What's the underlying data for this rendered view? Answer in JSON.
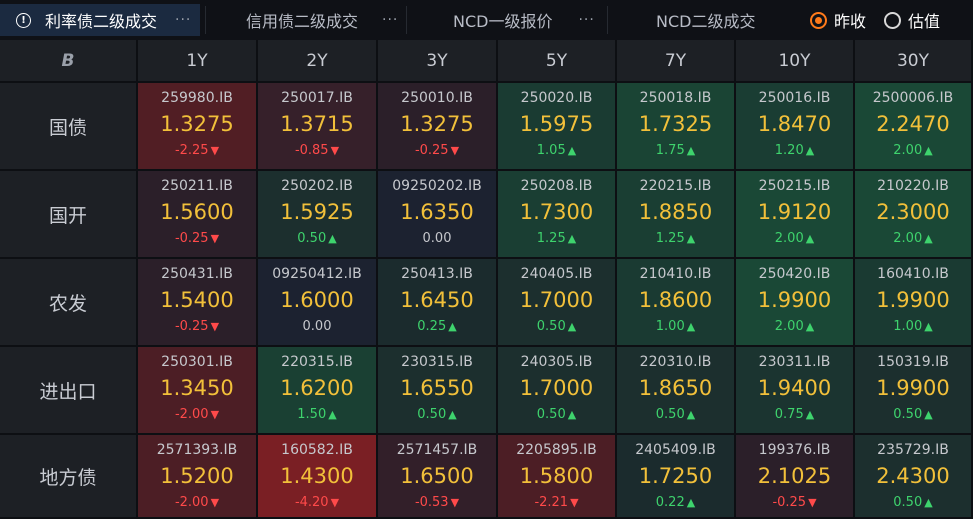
{
  "tabs": [
    {
      "label": "利率债二级成交",
      "more": "···",
      "active": true,
      "info_icon": "!"
    },
    {
      "label": "信用债二级成交",
      "more": "···",
      "active": false
    },
    {
      "label": "NCD一级报价",
      "more": "···",
      "active": false
    },
    {
      "label": "NCD二级成交",
      "more": "",
      "active": false
    }
  ],
  "radio": [
    {
      "label": "昨收",
      "checked": true
    },
    {
      "label": "估值",
      "checked": false
    }
  ],
  "corner_logo": "B",
  "columns": [
    "1Y",
    "2Y",
    "3Y",
    "5Y",
    "7Y",
    "10Y",
    "30Y"
  ],
  "colors": {
    "yield": "#f2c03a",
    "up": "#3ed36d",
    "down": "#ff4a4a",
    "accent_radio": "#ff7a1a"
  },
  "rows": [
    {
      "label": "国债",
      "cells": [
        {
          "code": "259980.IB",
          "yield": "1.3275",
          "change": "-2.25",
          "dir": "down",
          "bg": "#511e24"
        },
        {
          "code": "250017.IB",
          "yield": "1.3715",
          "change": "-0.85",
          "dir": "down",
          "bg": "#36202a"
        },
        {
          "code": "250010.IB",
          "yield": "1.3275",
          "change": "-0.25",
          "dir": "down",
          "bg": "#2b1f29"
        },
        {
          "code": "250020.IB",
          "yield": "1.5975",
          "change": "1.05",
          "dir": "up",
          "bg": "#1a3b32"
        },
        {
          "code": "250018.IB",
          "yield": "1.7325",
          "change": "1.75",
          "dir": "up",
          "bg": "#1a4434"
        },
        {
          "code": "250016.IB",
          "yield": "1.8470",
          "change": "1.20",
          "dir": "up",
          "bg": "#1a3d33"
        },
        {
          "code": "2500006.IB",
          "yield": "2.2470",
          "change": "2.00",
          "dir": "up",
          "bg": "#1a4836"
        }
      ]
    },
    {
      "label": "国开",
      "cells": [
        {
          "code": "250211.IB",
          "yield": "1.5600",
          "change": "-0.25",
          "dir": "down",
          "bg": "#2b1f29"
        },
        {
          "code": "250202.IB",
          "yield": "1.5925",
          "change": "0.50",
          "dir": "up",
          "bg": "#1c2f2e"
        },
        {
          "code": "09250202.IB",
          "yield": "1.6350",
          "change": "0.00",
          "dir": "flat",
          "bg": "#1c2230"
        },
        {
          "code": "250208.IB",
          "yield": "1.7300",
          "change": "1.25",
          "dir": "up",
          "bg": "#1a3e33"
        },
        {
          "code": "220215.IB",
          "yield": "1.8850",
          "change": "1.25",
          "dir": "up",
          "bg": "#1a3e33"
        },
        {
          "code": "250215.IB",
          "yield": "1.9120",
          "change": "2.00",
          "dir": "up",
          "bg": "#1a4836"
        },
        {
          "code": "210220.IB",
          "yield": "2.3000",
          "change": "2.00",
          "dir": "up",
          "bg": "#1a4836"
        }
      ]
    },
    {
      "label": "农发",
      "cells": [
        {
          "code": "250431.IB",
          "yield": "1.5400",
          "change": "-0.25",
          "dir": "down",
          "bg": "#2b1f29"
        },
        {
          "code": "09250412.IB",
          "yield": "1.6000",
          "change": "0.00",
          "dir": "flat",
          "bg": "#1c2230"
        },
        {
          "code": "250413.IB",
          "yield": "1.6450",
          "change": "0.25",
          "dir": "up",
          "bg": "#1b2b2d"
        },
        {
          "code": "240405.IB",
          "yield": "1.7000",
          "change": "0.50",
          "dir": "up",
          "bg": "#1c2f2e"
        },
        {
          "code": "210410.IB",
          "yield": "1.8600",
          "change": "1.00",
          "dir": "up",
          "bg": "#1a3a32"
        },
        {
          "code": "250420.IB",
          "yield": "1.9900",
          "change": "2.00",
          "dir": "up",
          "bg": "#1a4836"
        },
        {
          "code": "160410.IB",
          "yield": "1.9900",
          "change": "1.00",
          "dir": "up",
          "bg": "#1a3a32"
        }
      ]
    },
    {
      "label": "进出口",
      "cells": [
        {
          "code": "250301.IB",
          "yield": "1.3450",
          "change": "-2.00",
          "dir": "down",
          "bg": "#4c1e25"
        },
        {
          "code": "220315.IB",
          "yield": "1.6200",
          "change": "1.50",
          "dir": "up",
          "bg": "#1a4033"
        },
        {
          "code": "230315.IB",
          "yield": "1.6550",
          "change": "0.50",
          "dir": "up",
          "bg": "#1c2f2e"
        },
        {
          "code": "240305.IB",
          "yield": "1.7000",
          "change": "0.50",
          "dir": "up",
          "bg": "#1c2f2e"
        },
        {
          "code": "220310.IB",
          "yield": "1.8650",
          "change": "0.50",
          "dir": "up",
          "bg": "#1c2f2e"
        },
        {
          "code": "230311.IB",
          "yield": "1.9400",
          "change": "0.75",
          "dir": "up",
          "bg": "#1b3430"
        },
        {
          "code": "150319.IB",
          "yield": "1.9900",
          "change": "0.50",
          "dir": "up",
          "bg": "#1c2f2e"
        }
      ]
    },
    {
      "label": "地方债",
      "cells": [
        {
          "code": "2571393.IB",
          "yield": "1.5200",
          "change": "-2.00",
          "dir": "down",
          "bg": "#4c1e25"
        },
        {
          "code": "160582.IB",
          "yield": "1.4300",
          "change": "-4.20",
          "dir": "down",
          "bg": "#7a1f24"
        },
        {
          "code": "2571457.IB",
          "yield": "1.6500",
          "change": "-0.53",
          "dir": "down",
          "bg": "#321f29"
        },
        {
          "code": "2205895.IB",
          "yield": "1.5800",
          "change": "-2.21",
          "dir": "down",
          "bg": "#4c1e25"
        },
        {
          "code": "2405409.IB",
          "yield": "1.7250",
          "change": "0.22",
          "dir": "up",
          "bg": "#1b2b2d"
        },
        {
          "code": "199376.IB",
          "yield": "2.1025",
          "change": "-0.25",
          "dir": "down",
          "bg": "#2b1f29"
        },
        {
          "code": "235729.IB",
          "yield": "2.4300",
          "change": "0.50",
          "dir": "up",
          "bg": "#1c2f2e"
        }
      ]
    }
  ]
}
